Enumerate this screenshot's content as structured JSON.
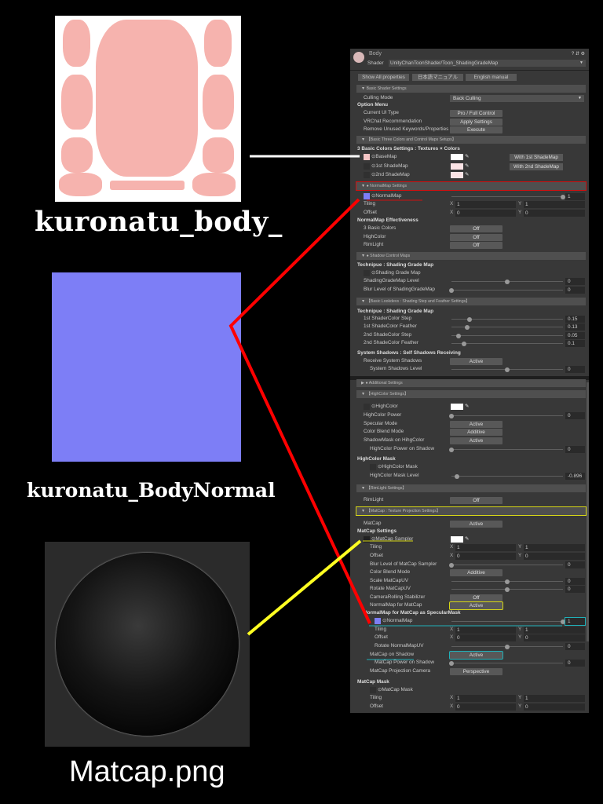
{
  "images": [
    {
      "caption": "kuronatu_body_"
    },
    {
      "caption": "kuronatu_BodyNormal"
    },
    {
      "caption": "Matcap.png"
    }
  ],
  "inspector": {
    "title": "Body",
    "shader_label": "Shader",
    "shader_value": "UnityChanToonShader/Toon_ShadingGradeMap",
    "buttons": [
      "Show All properties",
      "日本語マニュアル",
      "English manual"
    ],
    "rows": [
      {
        "t": "sec",
        "label": "Basic Shader Settings"
      },
      {
        "t": "dd",
        "label": "Culling Mode",
        "lv": 1,
        "value": "Back Culling"
      },
      {
        "t": "head",
        "label": "Option Menu"
      },
      {
        "t": "btn",
        "label": "Current UI Type",
        "lv": 1,
        "value": "Pro / Full Control"
      },
      {
        "t": "btn",
        "label": "VRChat Recommendation",
        "lv": 1,
        "value": "Apply Settings"
      },
      {
        "t": "btn",
        "label": "Remove Unused Keywords/Properties",
        "lv": 1,
        "value": "Execute"
      },
      {
        "t": "sec",
        "label": "【Basic Three Colors and Control Maps Setups】"
      },
      {
        "t": "head",
        "label": "3 Basic Colors Settings : Textures × Colors"
      },
      {
        "t": "tex",
        "label": "⊙BaseMap",
        "lv": 1,
        "swatch": "#f4c4c4",
        "color": "#ffffff",
        "side": "With 1st ShadeMap"
      },
      {
        "t": "tex",
        "label": "⊙1st ShadeMap",
        "lv": 1,
        "color": "#fce4e6",
        "side": "With 2nd ShadeMap"
      },
      {
        "t": "tex",
        "label": "⊙2nd ShadeMap",
        "lv": 1,
        "color": "#fce4e6"
      },
      {
        "t": "sec",
        "label": "● NormalMap Settings",
        "outline": "#d01010"
      },
      {
        "t": "tex",
        "label": "⊙NormalMap",
        "lv": 1,
        "swatch": "#7d7ef6",
        "slider": 1,
        "value": "1"
      },
      {
        "t": "xy",
        "label": "Tiling",
        "lv": 1,
        "x": "1",
        "y": "1"
      },
      {
        "t": "xy",
        "label": "Offset",
        "lv": 1,
        "x": "0",
        "y": "0"
      },
      {
        "t": "head",
        "label": "NormalMap Effectiveness"
      },
      {
        "t": "btn",
        "label": "3 Basic Colors",
        "lv": 1,
        "value": "Off"
      },
      {
        "t": "btn",
        "label": "HighColor",
        "lv": 1,
        "value": "Off"
      },
      {
        "t": "btn",
        "label": "RimLight",
        "lv": 1,
        "value": "Off"
      },
      {
        "t": "sec",
        "label": "● Shadow Control Maps"
      },
      {
        "t": "head",
        "label": "Technipue : Shading Grade Map"
      },
      {
        "t": "tex",
        "label": "⊙Shading Grade Map",
        "lv": 1
      },
      {
        "t": "sl",
        "label": "ShadingGradeMap Level",
        "lv": 1,
        "frac": 0.5,
        "value": "0"
      },
      {
        "t": "sl",
        "label": "Blur Level of ShadingGradeMap",
        "lv": 1,
        "frac": 0,
        "value": "0"
      },
      {
        "t": "sec",
        "label": "【Basic Lookdevs : Shading Step and Feather Settings】"
      },
      {
        "t": "head",
        "label": "Technipue : Shading Grade Map"
      },
      {
        "t": "sl",
        "label": "1st ShaderColor Step",
        "lv": 1,
        "frac": 0.16,
        "value": "0.15"
      },
      {
        "t": "sl",
        "label": "1st ShadeColor Feather",
        "lv": 1,
        "frac": 0.14,
        "value": "0.13"
      },
      {
        "t": "sl",
        "label": "2nd ShadeColor Step",
        "lv": 1,
        "frac": 0.06,
        "value": "0.05"
      },
      {
        "t": "sl",
        "label": "2nd ShadeColor Feather",
        "lv": 1,
        "frac": 0.11,
        "value": "0.1"
      },
      {
        "t": "head",
        "label": "System Shadows : Self Shadows Receiving"
      },
      {
        "t": "btn",
        "label": "Receive System Shadows",
        "lv": 1,
        "value": "Active"
      },
      {
        "t": "sl",
        "label": "System Shadows Level",
        "lv": 2,
        "frac": 0.5,
        "value": "0"
      },
      {
        "t": "sec",
        "label": "● Additional Settings",
        "collapsed": true
      },
      {
        "t": "sec",
        "label": "【HighColor Settings】"
      },
      {
        "t": "tex",
        "label": "⊙HighColor",
        "lv": 1,
        "color": "#ffffff"
      },
      {
        "t": "sl",
        "label": "HighColor Power",
        "lv": 1,
        "frac": 0,
        "value": "0"
      },
      {
        "t": "btn",
        "label": "Specular Mode",
        "lv": 1,
        "value": "Active"
      },
      {
        "t": "btn",
        "label": "Color Blend Mode",
        "lv": 1,
        "value": "Additive"
      },
      {
        "t": "btn",
        "label": "ShadowMask on HihgColor",
        "lv": 1,
        "value": "Active"
      },
      {
        "t": "sl",
        "label": "HighColor Power on Shadow",
        "lv": 2,
        "frac": 0,
        "value": "0"
      },
      {
        "t": "head",
        "label": "HighColor Mask"
      },
      {
        "t": "tex",
        "label": "⊙HighColor Mask",
        "lv": 2
      },
      {
        "t": "sl",
        "label": "HighColor Mask Level",
        "lv": 2,
        "frac": 0.052,
        "value": "-0.896"
      },
      {
        "t": "sec",
        "label": "【RimLight Settings】"
      },
      {
        "t": "btn",
        "label": "RimLight",
        "lv": 1,
        "value": "Off"
      },
      {
        "t": "sec",
        "label": "【MatCap : Texture Projection Settings】",
        "outline": "#d6d616"
      },
      {
        "t": "btn",
        "label": "MatCap",
        "lv": 1,
        "value": "Active"
      },
      {
        "t": "head",
        "label": "MatCap Settings"
      },
      {
        "t": "tex",
        "label": "⊙MatCap Sampler",
        "lv": 1,
        "swatch": "#222222",
        "color": "#ffffff"
      },
      {
        "t": "xy",
        "label": "Tiling",
        "lv": 2,
        "x": "1",
        "y": "1"
      },
      {
        "t": "xy",
        "label": "Offset",
        "lv": 2,
        "x": "0",
        "y": "0"
      },
      {
        "t": "sl",
        "label": "Blur Level of MatCap Sampler",
        "lv": 2,
        "frac": 0,
        "value": "0"
      },
      {
        "t": "btn",
        "label": "Color Blend Mode",
        "lv": 2,
        "value": "Additive"
      },
      {
        "t": "sl",
        "label": "Scale MatCapUV",
        "lv": 2,
        "frac": 0.5,
        "value": "0"
      },
      {
        "t": "sl",
        "label": "Rotate MatCapUV",
        "lv": 2,
        "frac": 0.5,
        "value": "0"
      },
      {
        "t": "btn",
        "label": "CameraRolling Stabilizer",
        "lv": 2,
        "value": "Off"
      },
      {
        "t": "btn",
        "label": "NormalMap for MatCap",
        "lv": 2,
        "value": "Active",
        "outline": "#d6d616"
      },
      {
        "t": "head",
        "label": "NormalMap for MatCap as SpecularMask",
        "lv": 1
      },
      {
        "t": "tex",
        "label": "⊙NormalMap",
        "lv": 3,
        "swatch": "#7d7ef6",
        "slider": 1,
        "value": "1",
        "outline": "#20b0b8"
      },
      {
        "t": "xy",
        "label": "Tiling",
        "lv": 3,
        "x": "1",
        "y": "1"
      },
      {
        "t": "xy",
        "label": "Offset",
        "lv": 3,
        "x": "0",
        "y": "0"
      },
      {
        "t": "sl",
        "label": "Rotate NormalMapUV",
        "lv": 3,
        "frac": 0.5,
        "value": "0"
      },
      {
        "t": "btn",
        "label": "MatCap on Shadow",
        "lv": 2,
        "value": "Active",
        "outline": "#20b0b8"
      },
      {
        "t": "sl",
        "label": "MatCap Power on Shadow",
        "lv": 3,
        "frac": 0,
        "value": "0"
      },
      {
        "t": "btn",
        "label": "MatCap Projection Camera",
        "lv": 2,
        "value": "Perspective"
      },
      {
        "t": "head",
        "label": "MatCap Mask"
      },
      {
        "t": "tex",
        "label": "⊙MatCap Mask",
        "lv": 2
      },
      {
        "t": "xy",
        "label": "Tiling",
        "lv": 2,
        "x": "1",
        "y": "1"
      },
      {
        "t": "xy",
        "label": "Offset",
        "lv": 2,
        "x": "0",
        "y": "0"
      }
    ]
  },
  "annotation_colors": {
    "white": "#ffffff",
    "red": "#ff0000",
    "yellow": "#ffff20",
    "cyan": "#20b0b8"
  }
}
